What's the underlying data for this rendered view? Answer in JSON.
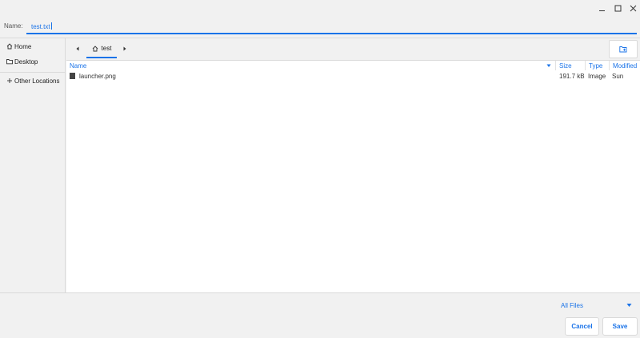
{
  "window": {
    "controls": [
      "minimize",
      "maximize",
      "close"
    ]
  },
  "name_field": {
    "label": "Name:",
    "value": "test.txt"
  },
  "sidebar": {
    "items": [
      {
        "label": "Home",
        "icon": "home-icon"
      },
      {
        "label": "Desktop",
        "icon": "folder-icon"
      },
      {
        "label": "Other Locations",
        "icon": "plus-icon"
      }
    ]
  },
  "pathbar": {
    "current": "test"
  },
  "file_list": {
    "columns": [
      "Name",
      "Size",
      "Type",
      "Modified"
    ],
    "rows": [
      {
        "name": "launcher.png",
        "size": "191.7 kB",
        "type": "Image",
        "modified": "Sun"
      }
    ]
  },
  "footer": {
    "filter": "All Files",
    "cancel_label": "Cancel",
    "save_label": "Save"
  },
  "colors": {
    "accent": "#1a73e8",
    "background": "#f1f1f1"
  }
}
